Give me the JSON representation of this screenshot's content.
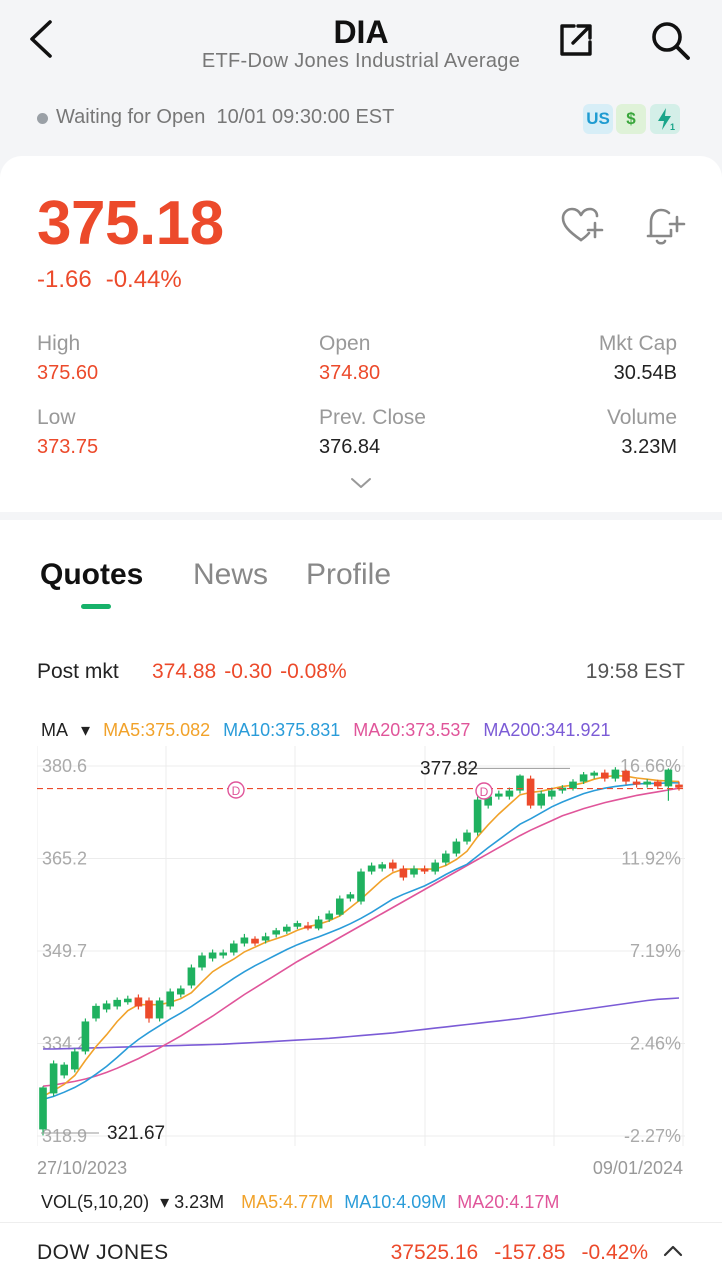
{
  "header": {
    "title": "DIA",
    "subtitle": "ETF-Dow Jones Industrial Average",
    "icons": [
      "back-chevron-icon",
      "share-icon",
      "search-icon"
    ]
  },
  "status": {
    "text": "Waiting for Open",
    "time": "10/01 09:30:00 EST",
    "badges": [
      "US",
      "$",
      "flash"
    ]
  },
  "quote": {
    "price": "375.18",
    "change": "-1.66",
    "change_pct": "-0.44%",
    "color": "#ec4a2b"
  },
  "stats": {
    "high_label": "High",
    "high": "375.60",
    "open_label": "Open",
    "open": "374.80",
    "mktcap_label": "Mkt Cap",
    "mktcap": "30.54B",
    "low_label": "Low",
    "low": "373.75",
    "prev_label": "Prev. Close",
    "prev": "376.84",
    "volume_label": "Volume",
    "volume": "3.23M"
  },
  "tabs": [
    {
      "label": "Quotes",
      "active": true
    },
    {
      "label": "News",
      "active": false
    },
    {
      "label": "Profile",
      "active": false
    }
  ],
  "post_market": {
    "label": "Post mkt",
    "price": "374.88",
    "change": "-0.30",
    "change_pct": "-0.08%",
    "time": "19:58 EST"
  },
  "chart_data": {
    "type": "candlestick",
    "ma_selector": "MA",
    "ma": {
      "ma5": "MA5:375.082",
      "ma10": "MA10:375.831",
      "ma20": "MA20:373.537",
      "ma200": "MA200:341.921"
    },
    "colors": {
      "up": "#1fb15f",
      "down": "#ec4a2b",
      "ma5": "#f1a22a",
      "ma10": "#2a9cd9",
      "ma20": "#e0559a",
      "ma200": "#7b5bd6"
    },
    "y_labels": [
      "380.6",
      "365.2",
      "349.7",
      "334.2",
      "318.9"
    ],
    "pct_labels": [
      "16.66%",
      "11.92%",
      "7.19%",
      "2.46%",
      "-2.27%"
    ],
    "ylim": [
      318.9,
      380.6
    ],
    "x_labels": [
      "27/10/2023",
      "09/01/2024"
    ],
    "high_marker": "377.82",
    "low_marker": "321.67",
    "dividend_marker": "D",
    "ref_line": 376.84,
    "candles": [
      [
        320,
        327,
        319,
        327.2
      ],
      [
        326,
        331,
        325.5,
        331.5
      ],
      [
        329,
        330.8,
        328.5,
        331.2
      ],
      [
        330,
        333,
        329.5,
        333.5
      ],
      [
        333,
        338,
        332.5,
        338.5
      ],
      [
        338.5,
        340.6,
        338,
        341
      ],
      [
        340,
        341,
        339.5,
        341.5
      ],
      [
        340.5,
        341.6,
        340,
        342
      ],
      [
        341.2,
        341.8,
        340.8,
        342.3
      ],
      [
        342,
        340.5,
        340,
        342.5
      ],
      [
        341.5,
        338.5,
        337.8,
        342
      ],
      [
        338.5,
        341.5,
        338,
        342
      ],
      [
        340.5,
        343,
        340,
        343.5
      ],
      [
        342.5,
        343.5,
        342,
        344
      ],
      [
        344,
        347,
        343.5,
        347.5
      ],
      [
        347,
        349,
        346.5,
        349.5
      ],
      [
        348.5,
        349.5,
        348,
        350
      ],
      [
        349,
        349.5,
        348.5,
        350
      ],
      [
        349.5,
        351,
        349,
        351.5
      ],
      [
        351,
        352,
        350.5,
        352.6
      ],
      [
        351.8,
        351,
        350.6,
        352.2
      ],
      [
        351.5,
        352.2,
        351,
        352.8
      ],
      [
        352.5,
        353.2,
        352,
        353.6
      ],
      [
        353,
        353.8,
        352.6,
        354.2
      ],
      [
        353.8,
        354.4,
        353.4,
        354.8
      ],
      [
        354,
        353.5,
        353.2,
        354.6
      ],
      [
        353.5,
        355,
        353.2,
        355.6
      ],
      [
        355,
        356,
        354.6,
        356.5
      ],
      [
        355.8,
        358.5,
        355.5,
        359
      ],
      [
        358.5,
        359.2,
        358,
        359.6
      ],
      [
        358,
        363,
        357.5,
        363.5
      ],
      [
        363,
        364,
        362.5,
        364.5
      ],
      [
        363.5,
        364.2,
        363,
        364.6
      ],
      [
        364.5,
        363.5,
        363,
        365
      ],
      [
        363.5,
        362,
        361.5,
        364
      ],
      [
        362.5,
        363.5,
        362,
        364
      ],
      [
        363.5,
        363,
        362.6,
        364
      ],
      [
        363,
        364.5,
        362.5,
        365
      ],
      [
        364.5,
        366,
        364,
        366.5
      ],
      [
        366,
        368,
        365.5,
        368.5
      ],
      [
        368,
        369.5,
        367.5,
        370
      ],
      [
        369.5,
        375,
        369,
        375.5
      ],
      [
        374,
        375.5,
        373.5,
        376
      ],
      [
        375.5,
        376,
        375,
        376.5
      ],
      [
        375.5,
        376.5,
        375,
        377
      ],
      [
        376.5,
        379,
        376,
        379.2
      ],
      [
        378.5,
        374,
        373.5,
        379
      ],
      [
        374,
        376,
        373.5,
        376.5
      ],
      [
        375.5,
        376.5,
        375,
        377
      ],
      [
        376.5,
        377,
        376,
        377.4
      ],
      [
        376.8,
        378,
        376.5,
        378.4
      ],
      [
        378,
        379.2,
        377.6,
        379.6
      ],
      [
        379,
        379.5,
        378.5,
        379.8
      ],
      [
        379.5,
        378.5,
        378,
        380
      ],
      [
        378.5,
        380,
        378,
        380.4
      ],
      [
        379.8,
        378,
        377.5,
        380
      ],
      [
        378,
        377.5,
        377,
        378.4
      ],
      [
        377.5,
        378,
        377,
        378.4
      ],
      [
        378,
        377.2,
        376.8,
        378.3
      ],
      [
        377.2,
        380,
        374.8,
        380.2
      ],
      [
        377.5,
        377,
        376.5,
        378
      ]
    ],
    "ma5_values": [
      325.5,
      326.5,
      327.5,
      329,
      331.5,
      333.8,
      335.8,
      338,
      339.8,
      340.8,
      340.8,
      340.8,
      341.2,
      341.8,
      342.8,
      344.6,
      346.3,
      347.4,
      348.4,
      349.6,
      350.4,
      351.2,
      351.8,
      352.4,
      353.2,
      353.8,
      354.2,
      354.8,
      355.6,
      357,
      358.4,
      360,
      361.6,
      362.8,
      363.4,
      363.4,
      363.4,
      363.4,
      364,
      365,
      366.4,
      368.8,
      370.8,
      372.6,
      374.2,
      375.8,
      376.2,
      376.4,
      376.8,
      377.2,
      377.4,
      377.8,
      378.4,
      378.8,
      379,
      378.9,
      378.6,
      378.4,
      378.2,
      378.1,
      378
    ],
    "ma10_values": [
      325,
      325.5,
      326.2,
      327,
      328,
      329.2,
      330.5,
      332,
      333.6,
      335,
      336.2,
      337.3,
      338.4,
      339.4,
      340.5,
      341.7,
      342.8,
      344,
      345.2,
      346.3,
      347.3,
      348.2,
      349.1,
      350,
      350.8,
      351.5,
      352.1,
      352.8,
      353.5,
      354.3,
      355.2,
      356.2,
      357.3,
      358.4,
      359.2,
      359.9,
      360.6,
      361.5,
      362.5,
      363.4,
      364.2,
      365.6,
      367,
      368.3,
      369.6,
      370.9,
      371.8,
      372.8,
      373.8,
      374.6,
      375.3,
      376,
      376.5,
      376.9,
      377.2,
      377.4,
      377.6,
      377.7,
      377.7,
      377.8,
      377.8
    ],
    "ma20_values": [
      327.2,
      327.4,
      327.7,
      328,
      328.4,
      328.9,
      329.5,
      330.2,
      331,
      331.8,
      332.7,
      333.6,
      334.6,
      335.6,
      336.7,
      337.8,
      338.9,
      340.1,
      341.3,
      342.5,
      343.6,
      344.7,
      345.8,
      346.9,
      348,
      349,
      350,
      351,
      352,
      353,
      354,
      355,
      356,
      357,
      358,
      359,
      360,
      361,
      362,
      363,
      364,
      365,
      366,
      367,
      368,
      369,
      369.9,
      370.7,
      371.5,
      372.3,
      372.9,
      373.5,
      374,
      374.5,
      374.9,
      375.3,
      375.7,
      376,
      376.3,
      376.6,
      376.9
    ],
    "ma200_values": [
      333.4,
      333.4,
      333.45,
      333.5,
      333.55,
      333.6,
      333.65,
      333.7,
      333.75,
      333.8,
      333.85,
      333.9,
      333.95,
      334,
      334.05,
      334.1,
      334.15,
      334.2,
      334.3,
      334.4,
      334.5,
      334.6,
      334.7,
      334.8,
      334.9,
      335,
      335.1,
      335.2,
      335.35,
      335.5,
      335.65,
      335.8,
      335.95,
      336.1,
      336.3,
      336.5,
      336.7,
      336.9,
      337.1,
      337.3,
      337.5,
      337.7,
      337.9,
      338.1,
      338.3,
      338.5,
      338.75,
      339,
      339.25,
      339.5,
      339.75,
      340,
      340.25,
      340.5,
      340.75,
      341,
      341.25,
      341.5,
      341.7,
      341.8,
      341.92
    ]
  },
  "volume": {
    "label": "VOL(5,10,20)",
    "value": "3.23M",
    "ma5": "MA5:4.77M",
    "ma10": "MA10:4.09M",
    "ma20": "MA20:4.17M"
  },
  "footer": {
    "index_name": "DOW JONES",
    "value": "37525.16",
    "change": "-157.85",
    "change_pct": "-0.42%"
  }
}
